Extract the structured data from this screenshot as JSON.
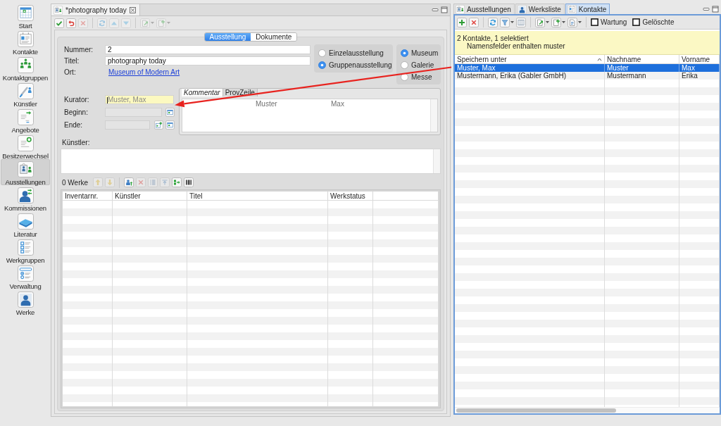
{
  "sidebar": {
    "items": [
      {
        "label": "Start",
        "kind": "calendar",
        "selected": false
      },
      {
        "label": "Kontakte",
        "kind": "contact",
        "selected": false
      },
      {
        "label": "Kontaktgruppen",
        "kind": "group",
        "selected": false
      },
      {
        "label": "Künstler",
        "kind": "artist",
        "selected": false
      },
      {
        "label": "Angebote",
        "kind": "offer",
        "selected": false
      },
      {
        "label": "Besitzerwechsel",
        "kind": "ownership",
        "selected": false
      },
      {
        "label": "Ausstellungen",
        "kind": "exhibition",
        "selected": true
      },
      {
        "label": "Kommissionen",
        "kind": "commission",
        "selected": false
      },
      {
        "label": "Literatur",
        "kind": "literature",
        "selected": false
      },
      {
        "label": "Werkgruppen",
        "kind": "workgroup",
        "selected": false
      },
      {
        "label": "Verwaltung",
        "kind": "admin",
        "selected": false
      },
      {
        "label": "Werke",
        "kind": "works",
        "selected": false
      }
    ]
  },
  "editor": {
    "tab": {
      "title": "*photography today",
      "kind": "exhibition"
    },
    "toolbar": [
      {
        "items": [
          {
            "kind": "save",
            "disabled": false,
            "menu": false
          },
          {
            "kind": "revert",
            "disabled": false,
            "menu": false
          },
          {
            "kind": "delete",
            "disabled": true,
            "menu": false
          }
        ]
      },
      {
        "items": [
          {
            "kind": "refresh",
            "disabled": true,
            "menu": false
          },
          {
            "kind": "up",
            "disabled": true,
            "menu": false
          },
          {
            "kind": "down",
            "disabled": true,
            "menu": false
          }
        ]
      },
      {
        "items": [
          {
            "kind": "export",
            "disabled": true,
            "menu": true
          },
          {
            "kind": "new",
            "disabled": true,
            "menu": true
          }
        ]
      }
    ],
    "sections": [
      {
        "label": "Ausstellung",
        "selected": true
      },
      {
        "label": "Dokumente",
        "selected": false
      }
    ],
    "fields": [
      {
        "label": "Nummer:",
        "value": "2"
      },
      {
        "label": "Titel:",
        "value": "photography today"
      }
    ],
    "location": {
      "label": "Ort:",
      "link": "Museum of Modern Art"
    },
    "exhibition_type": [
      {
        "label": "Einzelausstellung",
        "selected": false
      },
      {
        "label": "Gruppenausstellung",
        "selected": true
      }
    ],
    "venue_type": [
      {
        "label": "Museum",
        "selected": true
      },
      {
        "label": "Galerie",
        "selected": false
      },
      {
        "label": "Messe",
        "selected": false
      }
    ],
    "curator": {
      "label": "Kurator:",
      "placeholder": "Muster, Max",
      "focused": true
    },
    "dates": [
      {
        "label": "Beginn:",
        "disabled": true,
        "buttons": [
          {
            "kind": "calendar",
            "disabled": false,
            "menu": false
          }
        ]
      },
      {
        "label": "Ende:",
        "disabled": true,
        "buttons": [
          {
            "kind": "calendar_add",
            "disabled": false,
            "menu": false
          },
          {
            "kind": "calendar",
            "disabled": false,
            "menu": false
          }
        ]
      }
    ],
    "notes": {
      "tabs": [
        {
          "label": "Kommentar",
          "selected": true
        },
        {
          "label": "ProvZeile",
          "selected": false
        }
      ],
      "drag_preview": [
        "Muster",
        "Max"
      ]
    },
    "artists": {
      "label": "Künstler:"
    },
    "works": {
      "count": "0 Werke",
      "toolbar": [
        {
          "items": [
            {
              "kind": "move_up",
              "disabled": true,
              "menu": false
            },
            {
              "kind": "move_down",
              "disabled": true,
              "menu": false
            }
          ]
        },
        {
          "items": [
            {
              "kind": "add_person",
              "disabled": false,
              "menu": false
            },
            {
              "kind": "delete",
              "disabled": true,
              "menu": false
            },
            {
              "kind": "sort",
              "disabled": true,
              "menu": false
            },
            {
              "kind": "upload",
              "disabled": true,
              "menu": false
            },
            {
              "kind": "transfer",
              "disabled": false,
              "menu": false
            },
            {
              "kind": "barcode",
              "disabled": false,
              "menu": false
            }
          ]
        }
      ],
      "table": {
        "columns": [
          "Inventarnr.",
          "Künstler",
          "Titel",
          "Werkstatus"
        ]
      }
    }
  },
  "contacts": {
    "tabs": [
      {
        "label": "Ausstellungen",
        "kind": "exhibition",
        "selected": false
      },
      {
        "label": "Werksliste",
        "kind": "works",
        "selected": false
      },
      {
        "label": "Kontakte",
        "kind": "contact",
        "selected": true
      }
    ],
    "toolbar": [
      {
        "items": [
          {
            "kind": "add",
            "disabled": false,
            "menu": false
          },
          {
            "kind": "delete",
            "disabled": false,
            "menu": false
          }
        ]
      },
      {
        "items": [
          {
            "kind": "refresh",
            "disabled": false,
            "menu": false
          },
          {
            "kind": "filter",
            "disabled": false,
            "menu": true
          },
          {
            "kind": "columns",
            "disabled": false,
            "menu": false
          }
        ]
      },
      {
        "items": [
          {
            "kind": "export",
            "disabled": false,
            "menu": true
          },
          {
            "kind": "new",
            "disabled": false,
            "menu": true
          },
          {
            "kind": "report",
            "disabled": false,
            "menu": true
          }
        ]
      }
    ],
    "filters": [
      {
        "label": "Wartung",
        "checked": false
      },
      {
        "label": "Gelöschte",
        "checked": false
      }
    ],
    "info": {
      "summary": "2 Kontakte, 1 selektiert",
      "filter": "Namensfelder enthalten muster"
    },
    "table": {
      "columns": [
        {
          "label": "Speichern unter",
          "sorted": true
        },
        {
          "label": "Nachname",
          "sorted": false
        },
        {
          "label": "Vorname",
          "sorted": false
        }
      ],
      "rows": [
        {
          "cells": [
            "Muster, Max",
            "Muster",
            "Max"
          ],
          "selected": true
        },
        {
          "cells": [
            "Mustermann, Erika (Gabler GmbH)",
            "Mustermann",
            "Erika"
          ],
          "selected": false
        }
      ]
    }
  }
}
